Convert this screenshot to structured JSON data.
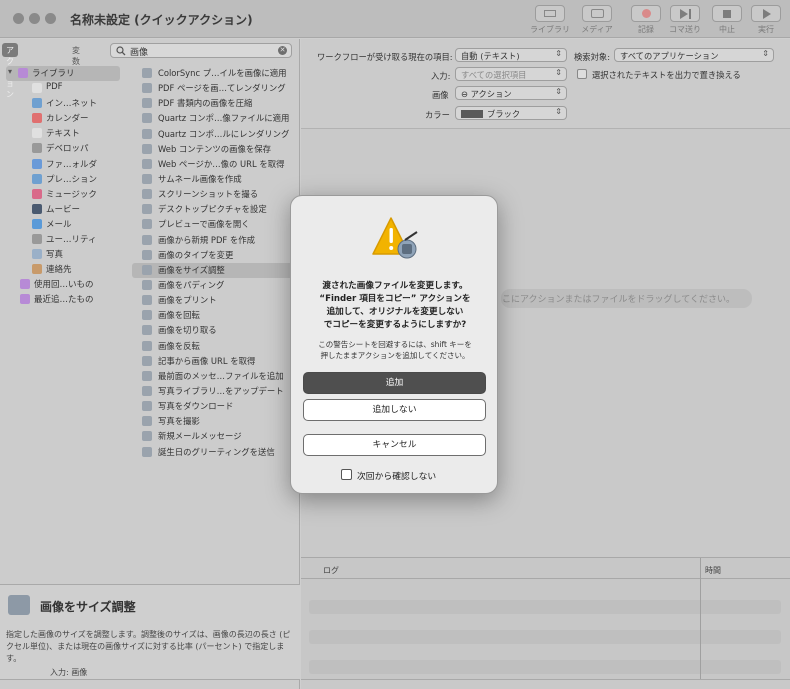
{
  "window": {
    "title": "名称未設定 (クイックアクション)",
    "toolbar": [
      {
        "label": "ライブラリ",
        "icon": "library-icon"
      },
      {
        "label": "メディア",
        "icon": "media-icon"
      },
      {
        "label": "記録",
        "icon": "record-icon"
      },
      {
        "label": "コマ送り",
        "icon": "step-icon"
      },
      {
        "label": "中止",
        "icon": "stop-icon"
      },
      {
        "label": "実行",
        "icon": "run-icon"
      }
    ]
  },
  "left": {
    "tabs": {
      "actions": "アクション",
      "variables": "変数"
    },
    "search": {
      "value": "画像"
    },
    "library": [
      {
        "label": "ライブラリ",
        "icon": "folder-icon",
        "color": "#b78ad6"
      },
      {
        "label": "PDF",
        "icon": "pdf-icon",
        "color": "#e0e0e0"
      },
      {
        "label": "インターネット",
        "icon": "globe-icon",
        "color": "#6fa0d0"
      },
      {
        "label": "カレンダー",
        "icon": "calendar-icon",
        "color": "#e07070"
      },
      {
        "label": "テキスト",
        "icon": "text-icon",
        "color": "#e0e0e0"
      },
      {
        "label": "デベロッパ",
        "icon": "developer-icon",
        "color": "#999999"
      },
      {
        "label": "ファイルとフォルダ",
        "icon": "folder-icon",
        "color": "#6a9ad8"
      },
      {
        "label": "プレゼンテーション",
        "icon": "presentation-icon",
        "color": "#6fa0d0"
      },
      {
        "label": "ミュージック",
        "icon": "music-icon",
        "color": "#d96a8a"
      },
      {
        "label": "ムービー",
        "icon": "movie-icon",
        "color": "#4a5a70"
      },
      {
        "label": "メール",
        "icon": "mail-icon",
        "color": "#5a9ad8"
      },
      {
        "label": "ユーティリティ",
        "icon": "utility-icon",
        "color": "#999999"
      },
      {
        "label": "写真",
        "icon": "photo-icon",
        "color": "#9ab0c8"
      },
      {
        "label": "連絡先",
        "icon": "contacts-icon",
        "color": "#c89a6a"
      },
      {
        "label": "使用回数の多いもの",
        "icon": "smart-folder-icon",
        "color": "#b78ad6"
      },
      {
        "label": "最近追加したもの",
        "icon": "smart-folder-icon",
        "color": "#b78ad6"
      }
    ],
    "library_display": [
      "ライブラリ",
      "PDF",
      "イン…ネット",
      "カレンダー",
      "テキスト",
      "デベロッパ",
      "ファ…ォルダ",
      "プレ…ション",
      "ミュージック",
      "ムービー",
      "メール",
      "ユー…リティ",
      "写真",
      "連絡先",
      "使用回…いもの",
      "最近追…たもの"
    ],
    "actions": [
      "ColorSync プ…イルを画像に適用",
      "PDF ページを画…てレンダリング",
      "PDF 書類内の画像を圧縮",
      "Quartz コンポ…像ファイルに適用",
      "Quartz コンポ…ルにレンダリング",
      "Web コンテンツの画像を保存",
      "Web ページか…像の URL を取得",
      "サムネール画像を作成",
      "スクリーンショットを撮る",
      "デスクトップピクチャを設定",
      "プレビューで画像を開く",
      "画像から新規 PDF を作成",
      "画像のタイプを変更",
      "画像をサイズ調整",
      "画像をパディング",
      "画像をプリント",
      "画像を回転",
      "画像を切り取る",
      "画像を反転",
      "記事から画像 URL を取得",
      "最前面のメッセ…ファイルを追加",
      "写真ライブラリ…をアップデート",
      "写真をダウンロード",
      "写真を撮影",
      "新規メールメッセージ",
      "誕生日のグリーティングを送信"
    ],
    "selected_action_index": 13,
    "description": {
      "title": "画像をサイズ調整",
      "body": "指定した画像のサイズを調整します。調整後のサイズは、画像の長辺の長さ (ピクセル単位)、または現在の画像サイズに対する比率 (パーセント) で指定します。",
      "input": "入力: 画像"
    }
  },
  "workflow": {
    "receives_label": "ワークフローが受け取る現在の項目:",
    "receives_value": "自動 (テキスト)",
    "search_target_label": "検索対象:",
    "search_target_value": "すべてのアプリケーション",
    "input_label": "入力:",
    "input_value": "すべての選択項目",
    "replace_text_label": "選択されたテキストを出力で置き換える",
    "image_label": "画像",
    "image_value": "⊖ アクション",
    "color_label": "カラー",
    "color_value": "ブラック",
    "drop_hint": "ここにアクションまたはファイルをドラッグしてください。"
  },
  "log": {
    "col_log": "ログ",
    "col_time": "時間"
  },
  "dialog": {
    "title": "渡された画像ファイルを変更します。“Finder 項目をコピー” アクションを追加して、オリジナルを変更しないでコピーを変更するようにしますか?",
    "title_lines": [
      "渡された画像ファイルを変更します。",
      "“Finder 項目をコピー” アクションを",
      "追加して、オリジナルを変更しない",
      "でコピーを変更するようにしますか?"
    ],
    "info_lines": [
      "この警告シートを回避するには、shift キーを",
      "押したままアクションを追加してください。"
    ],
    "add": "追加",
    "dont_add": "追加しない",
    "cancel": "キャンセル",
    "dont_ask": "次回から確認しない"
  },
  "colors": {
    "accent": "#4f4f4f",
    "warning": "#f2b300"
  }
}
